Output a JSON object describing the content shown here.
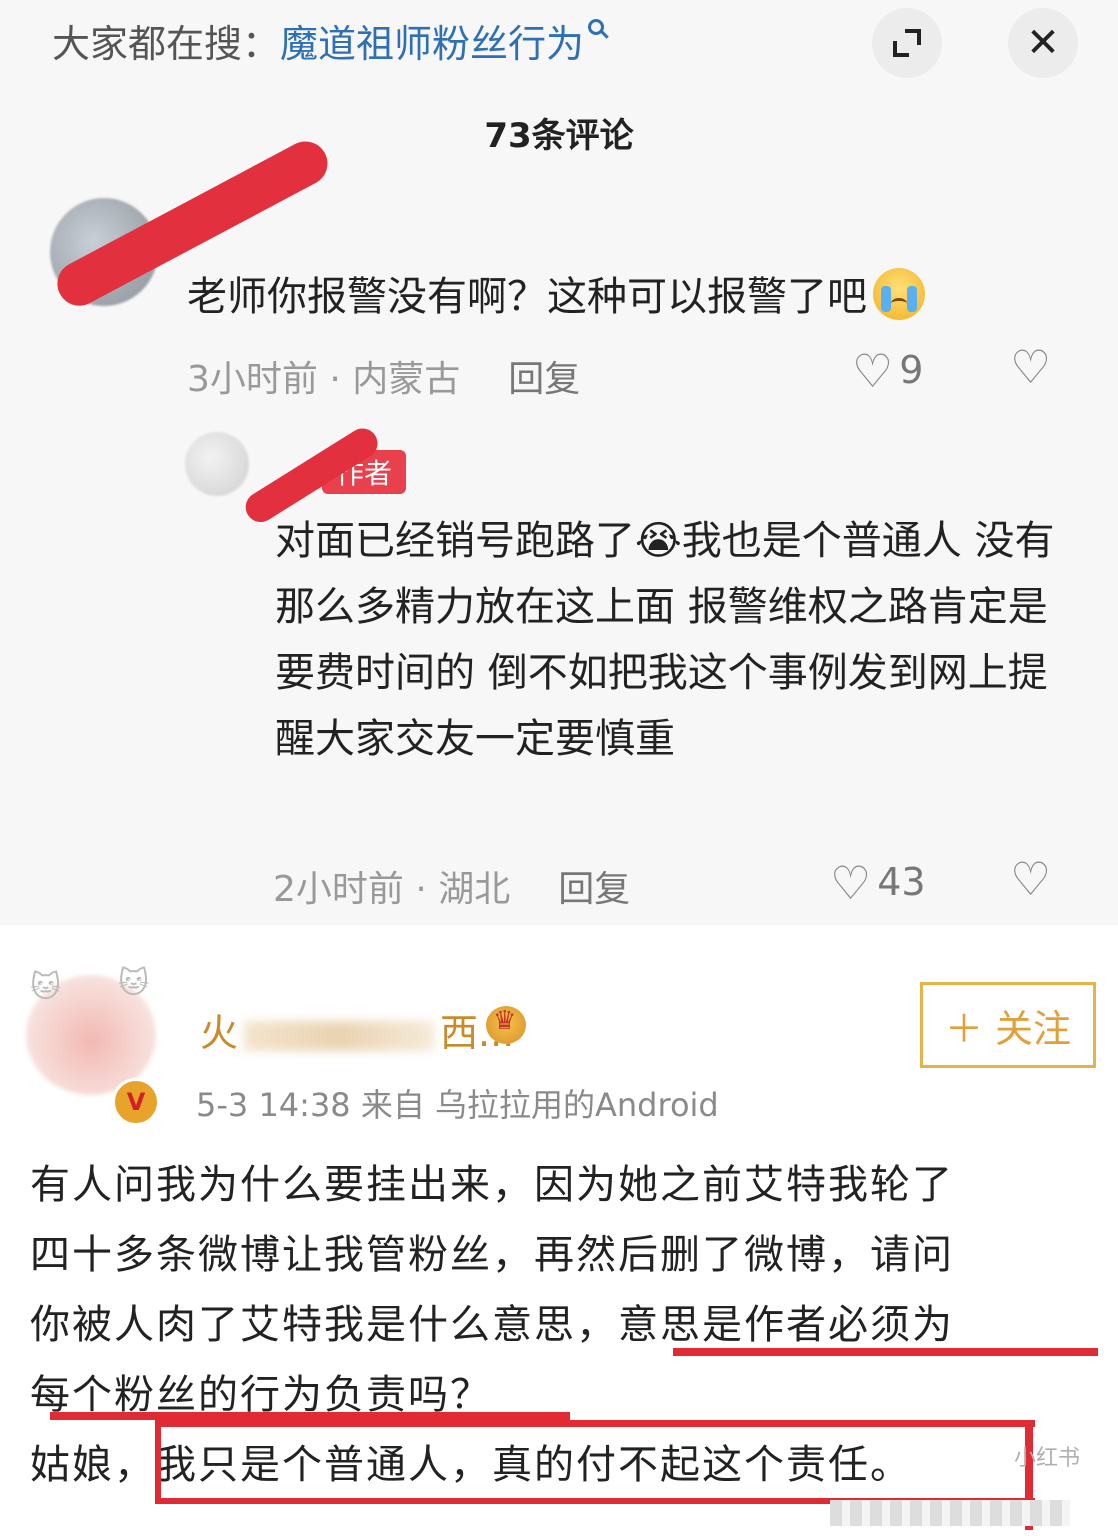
{
  "header": {
    "search_prefix": "大家都在搜：",
    "search_keyword": "魔道祖师粉丝行为",
    "comment_count": "73条评论",
    "close_label": "✕"
  },
  "comments": [
    {
      "text": "老师你报警没有啊？这种可以报警了吧",
      "time": "3小时前 · 内蒙古",
      "reply": "回复",
      "likes": "9"
    },
    {
      "author_badge": "作者",
      "text": "对面已经销号跑路了😭我也是个普通人 没有那么多精力放在这上面 报警维权之路肯定是要费时间的 倒不如把我这个事例发到网上提醒大家交友一定要慎重",
      "time": "2小时前 · 湖北",
      "reply": "回复",
      "likes": "43"
    }
  ],
  "weibo_post": {
    "username_start": "火",
    "username_end": "西...",
    "follow_label": "＋ 关注",
    "meta": "5-3 14:38  来自 乌拉拉用的Android",
    "body_line1": "有人问我为什么要挂出来，因为她之前艾特我轮了",
    "body_line2": "四十多条微博让我管粉丝，再然后删了微博，请问",
    "body_line3": "你被人肉了艾特我是什么意思，意思是作者必须为",
    "body_line4": "每个粉丝的行为负责吗？",
    "body_line5": "姑娘，我只是个普通人，真的付不起这个责任。",
    "verified_mark": "V",
    "watermark": "小红书"
  },
  "colors": {
    "accent_blue": "#2f6fb3",
    "author_badge": "#e8404c",
    "highlight_red": "#e02a34",
    "follow_gold": "#e0a03a"
  }
}
